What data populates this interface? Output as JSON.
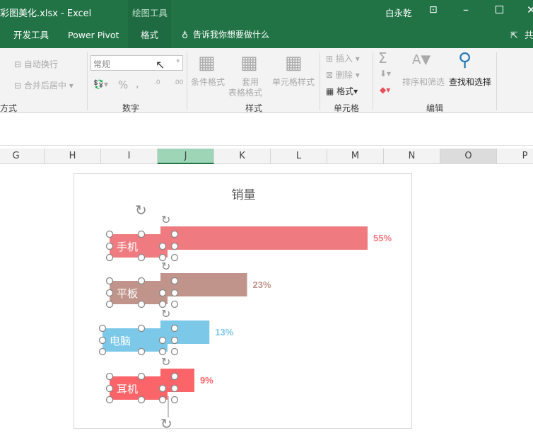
{
  "window": {
    "title": "彩图美化.xlsx  -  Excel",
    "context_tab": "绘图工具",
    "user": "白永乾"
  },
  "tabs": [
    {
      "label": "开发工具"
    },
    {
      "label": "Power Pivot"
    },
    {
      "label": "格式"
    }
  ],
  "tell_me": "告诉我你想要做什么",
  "share": "共",
  "ribbon": {
    "wrap_text": "自动换行",
    "merge_center": "合并后居中",
    "align_group": "方式",
    "number_format": "常规",
    "percent": "%",
    "comma": ",",
    "inc_dec": ".0",
    "dec_dec": ".00",
    "number_group": "数字",
    "cond_format": "条件格式",
    "table_format_1": "套用",
    "table_format_2": "表格格式",
    "cell_styles": "单元格样式",
    "styles_group": "样式",
    "insert": "插入",
    "delete": "删除",
    "format": "格式",
    "cells_group": "单元格",
    "sum": "Σ",
    "sort_filter": "排序和筛选",
    "find_select": "查找和选择",
    "editing_group": "编辑"
  },
  "columns": [
    "G",
    "H",
    "I",
    "J",
    "K",
    "L",
    "M",
    "N",
    "O",
    "P"
  ],
  "chart_data": {
    "type": "bar",
    "title": "销量",
    "categories": [
      "手机",
      "平板",
      "电脑",
      "耳机"
    ],
    "values": [
      55,
      23,
      13,
      9
    ],
    "labels": [
      "55%",
      "23%",
      "13%",
      "9%"
    ],
    "colors": [
      "#ef7b80",
      "#c0948a",
      "#7cc8e8",
      "#fb6469"
    ],
    "xlim": [
      0,
      60
    ]
  }
}
